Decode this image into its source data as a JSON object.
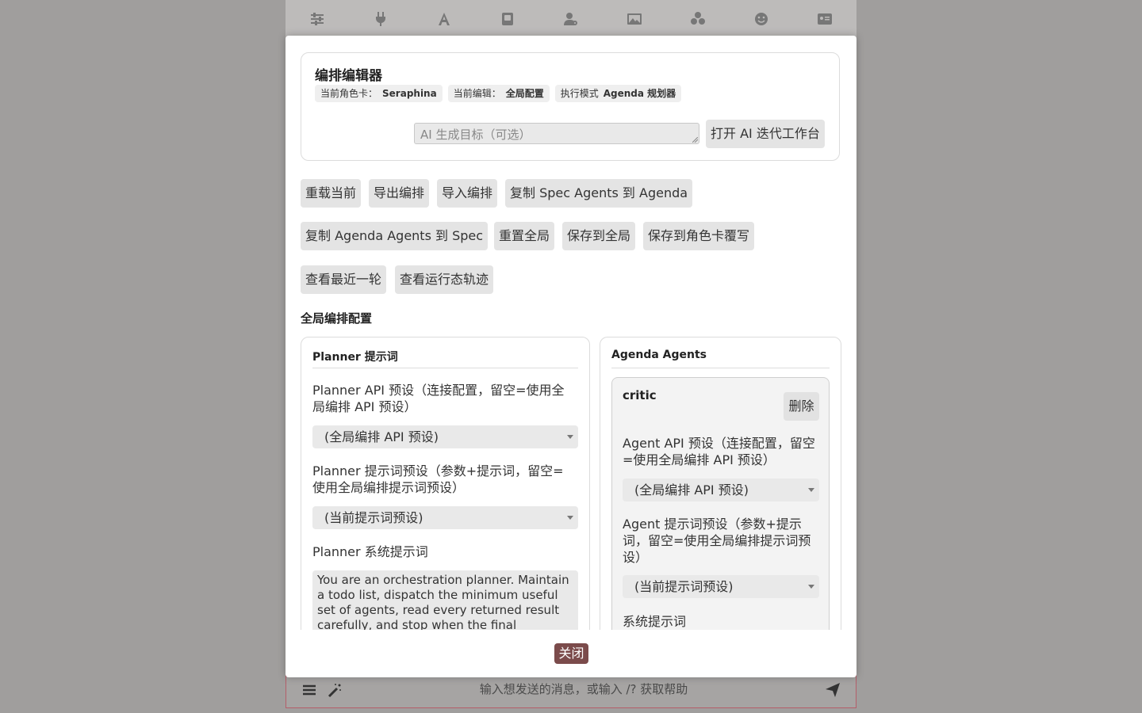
{
  "background": {
    "toolbar_icons": [
      "sliders-icon",
      "plug-icon",
      "font-icon",
      "book-icon",
      "user-gear-icon",
      "image-icon",
      "cubes-icon",
      "smiley-icon",
      "id-card-icon"
    ],
    "chat_placeholder": "输入想发送的消息，或输入 /? 获取帮助"
  },
  "modal": {
    "title": "编排编辑器",
    "chips": [
      {
        "label": "当前角色卡：",
        "value": "Seraphina"
      },
      {
        "label": "当前编辑：",
        "value": "全局配置"
      },
      {
        "label": "执行模式",
        "value": "Agenda 规划器"
      }
    ],
    "goal_placeholder": "AI 生成目标（可选）",
    "open_workbench": "打开 AI 迭代工作台",
    "actions": {
      "reload": "重载当前",
      "export": "导出编排",
      "import": "导入编排",
      "copy_spec_to_agenda": "复制 Spec Agents 到 Agenda",
      "copy_agenda_to_spec": "复制 Agenda Agents 到 Spec",
      "reset_global": "重置全局",
      "save_global": "保存到全局",
      "save_card_override": "保存到角色卡覆写",
      "view_last_round": "查看最近一轮",
      "view_runtime_trace": "查看运行态轨迹"
    },
    "section_title": "全局编排配置",
    "planner": {
      "heading": "Planner 提示词",
      "api_label": "Planner API 预设（连接配置，留空=使用全局编排 API 预设）",
      "api_value": "(全局编排 API 预设)",
      "prompt_label": "Planner 提示词预设（参数+提示词，留空=使用全局编排提示词预设）",
      "prompt_value": "(当前提示词预设)",
      "system_label": "Planner 系统提示词",
      "system_value": "You are an orchestration planner. Maintain a todo list, dispatch the minimum useful set of agents, read every returned result carefully, and stop when the final"
    },
    "agenda": {
      "heading": "Agenda Agents",
      "agent_name": "critic",
      "delete": "删除",
      "api_label": "Agent API 预设（连接配置，留空=使用全局编排 API 预设）",
      "api_value": "(全局编排 API 预设)",
      "prompt_label": "Agent 提示词预设（参数+提示词，留空=使用全局编排提示词预设）",
      "prompt_value": "(当前提示词预设)",
      "system_label": "系统提示词"
    },
    "close": "关闭"
  },
  "colors": {
    "overlay": "#a09e9d",
    "close_button": "#7b4b4b",
    "chat_border": "#b45e6a"
  }
}
